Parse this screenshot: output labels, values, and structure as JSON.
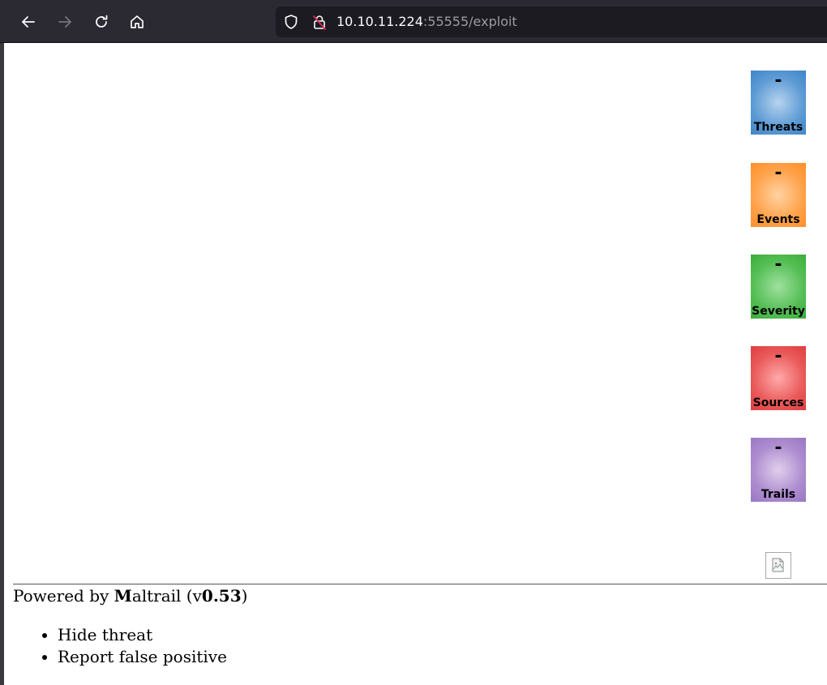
{
  "browser": {
    "url_host": "10.10.11.224",
    "url_rest": ":55555/exploit",
    "icons": [
      "back-icon",
      "forward-icon",
      "reload-icon",
      "home-icon",
      "shield-icon",
      "insecure-lock-icon"
    ]
  },
  "tiles": [
    {
      "value": "-",
      "label": "Threats",
      "color": "#5d9bd5"
    },
    {
      "value": "-",
      "label": "Events",
      "color": "#ffa24a"
    },
    {
      "value": "-",
      "label": "Severity",
      "color": "#55bf55"
    },
    {
      "value": "-",
      "label": "Sources",
      "color": "#ea5a5a"
    },
    {
      "value": "-",
      "label": "Trails",
      "color": "#ad8ccf"
    }
  ],
  "footer": {
    "powered_prefix": "Powered by ",
    "brand_initial": "M",
    "brand_rest": "altrail",
    "version_open": " (v",
    "version": "0.53",
    "version_close": ")"
  },
  "context_menu": {
    "items": [
      "Hide threat",
      "Report false positive"
    ]
  }
}
